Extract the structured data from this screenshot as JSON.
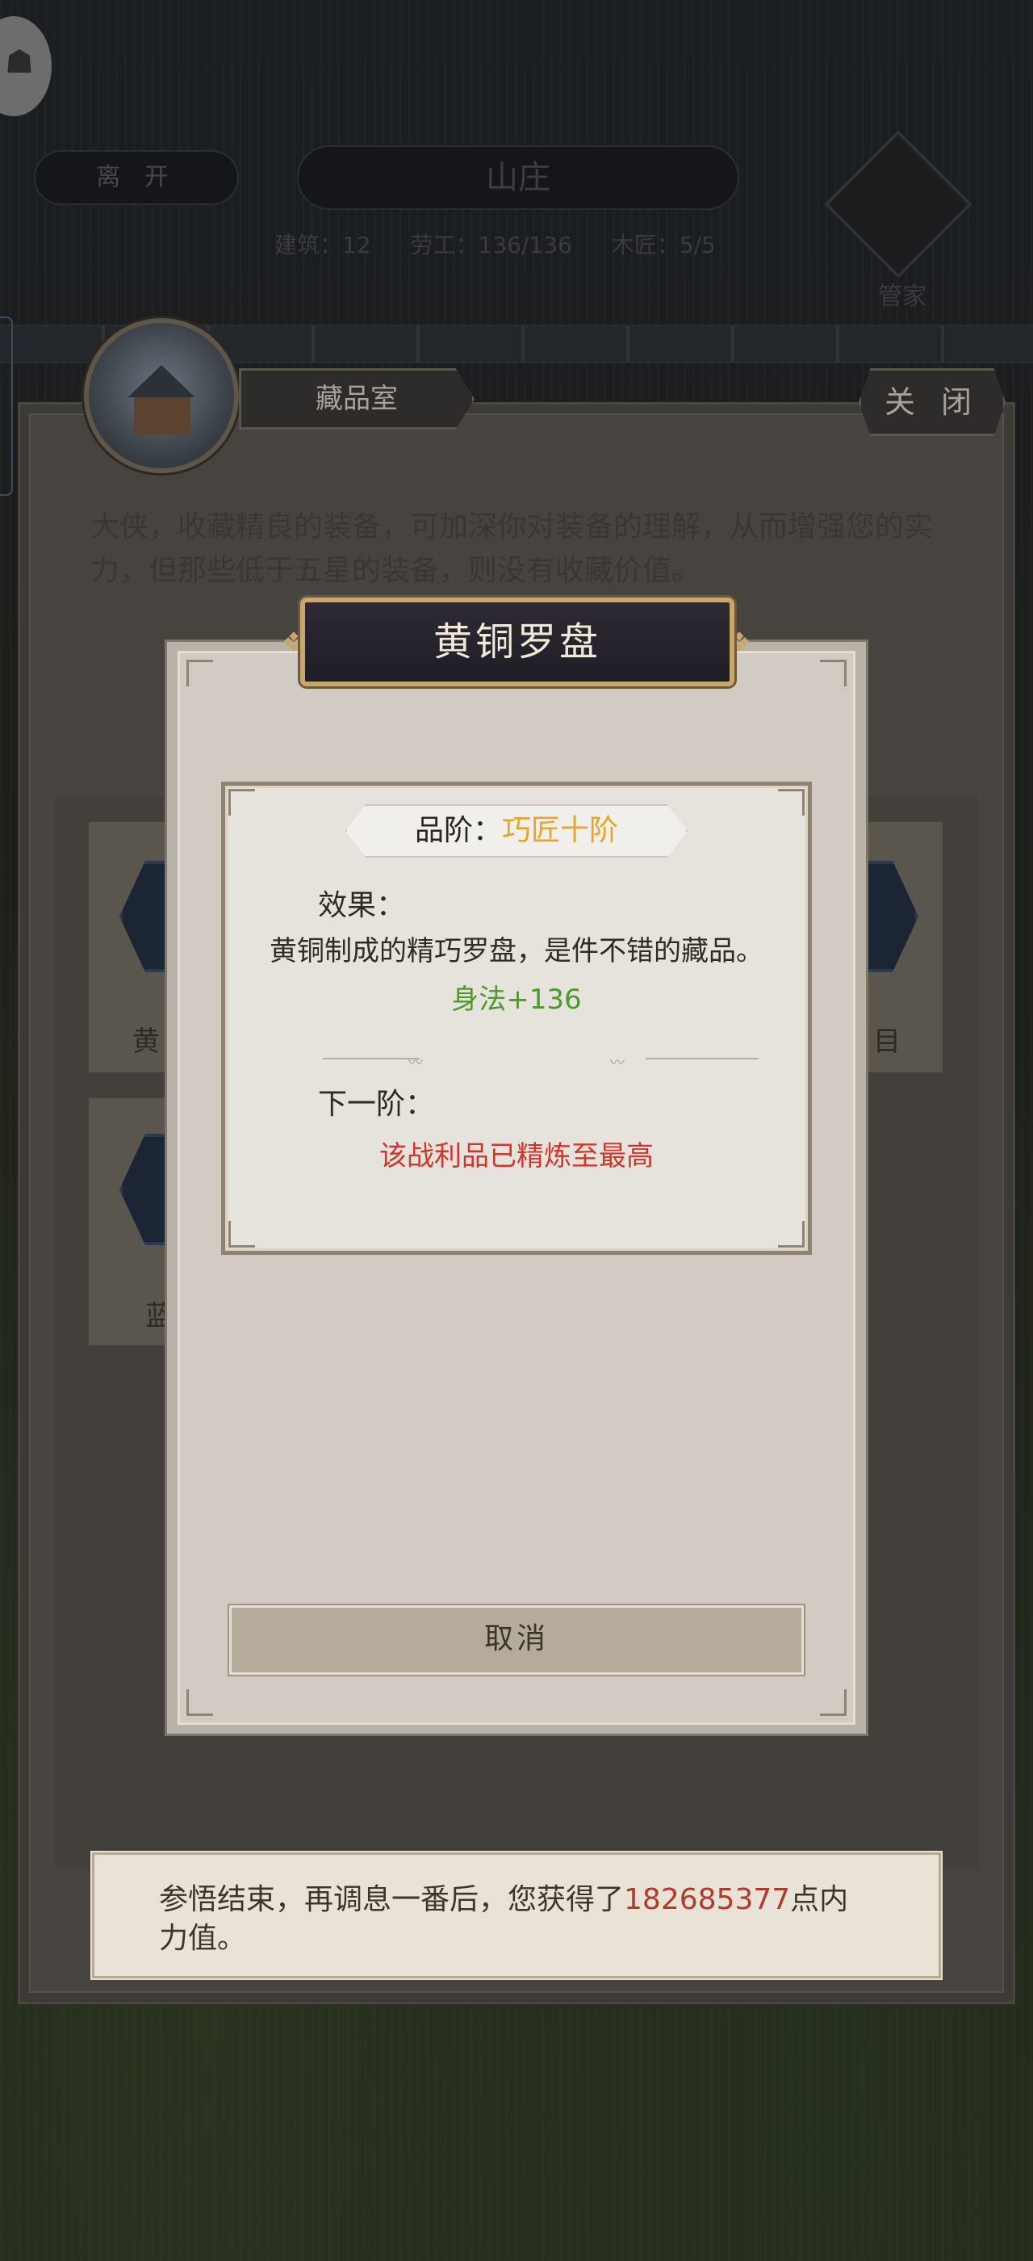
{
  "background": {
    "leave_label": "离 开",
    "title": "山庄",
    "stats": [
      "建筑：12",
      "劳工：136/136",
      "木匠：5/5"
    ],
    "steward_label": "管家"
  },
  "room": {
    "tab_label": "藏品室",
    "close_label": "关 闭",
    "description": "大侠，收藏精良的装备，可加深你对装备的理解，从而增强您的实力，但那些低于五星的装备，则没有收藏价值。",
    "tiles": [
      {
        "label": "黄"
      },
      {
        "label": "目"
      },
      {
        "label": "蓝"
      }
    ]
  },
  "notice": {
    "prefix": "参悟结束，再调息一番后，您获得了",
    "value": "182685377",
    "suffix": "点内力值。"
  },
  "modal": {
    "title": "黄铜罗盘",
    "grade_label": "品阶：",
    "grade_value": "巧匠十阶",
    "effect_label": "效果：",
    "effect_text": "黄铜制成的精巧罗盘，是件不错的藏品。",
    "effect_stat": "身法+136",
    "next_label": "下一阶：",
    "next_text": "该战利品已精炼至最高",
    "cancel_label": "取消"
  },
  "colors": {
    "grade_accent": "#e3a52a",
    "stat_green": "#4a9a2c",
    "max_red": "#d0362b",
    "notice_highlight": "#b03b2c",
    "title_gold": "#c8a86a"
  }
}
